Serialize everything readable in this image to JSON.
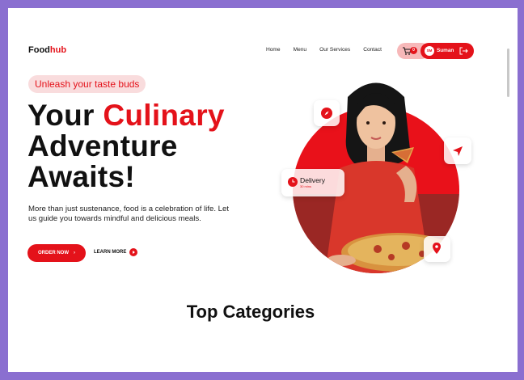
{
  "brand": {
    "logo_part1": "Food",
    "logo_part2": "hub",
    "accent": "#e4121a"
  },
  "nav": {
    "items": [
      "Home",
      "Menu",
      "Our Services",
      "Contact"
    ]
  },
  "cart": {
    "count": "0"
  },
  "user": {
    "avatar_text": "SM",
    "name": "Suman"
  },
  "hero": {
    "tagline": "Unleash your taste buds",
    "headline_part1": "Your ",
    "headline_highlight": "Culinary",
    "headline_part2": "Adventure",
    "headline_part3": "Awaits!",
    "description": "More than just sustenance, food is a celebration of life. Let us guide you towards mindful and delicious meals.",
    "order_label": "ORDER NOW",
    "learn_label": "LEARN MORE"
  },
  "delivery_card": {
    "label": "Delivery",
    "sub": "30 mins"
  },
  "section": {
    "title": "Top Categories"
  }
}
